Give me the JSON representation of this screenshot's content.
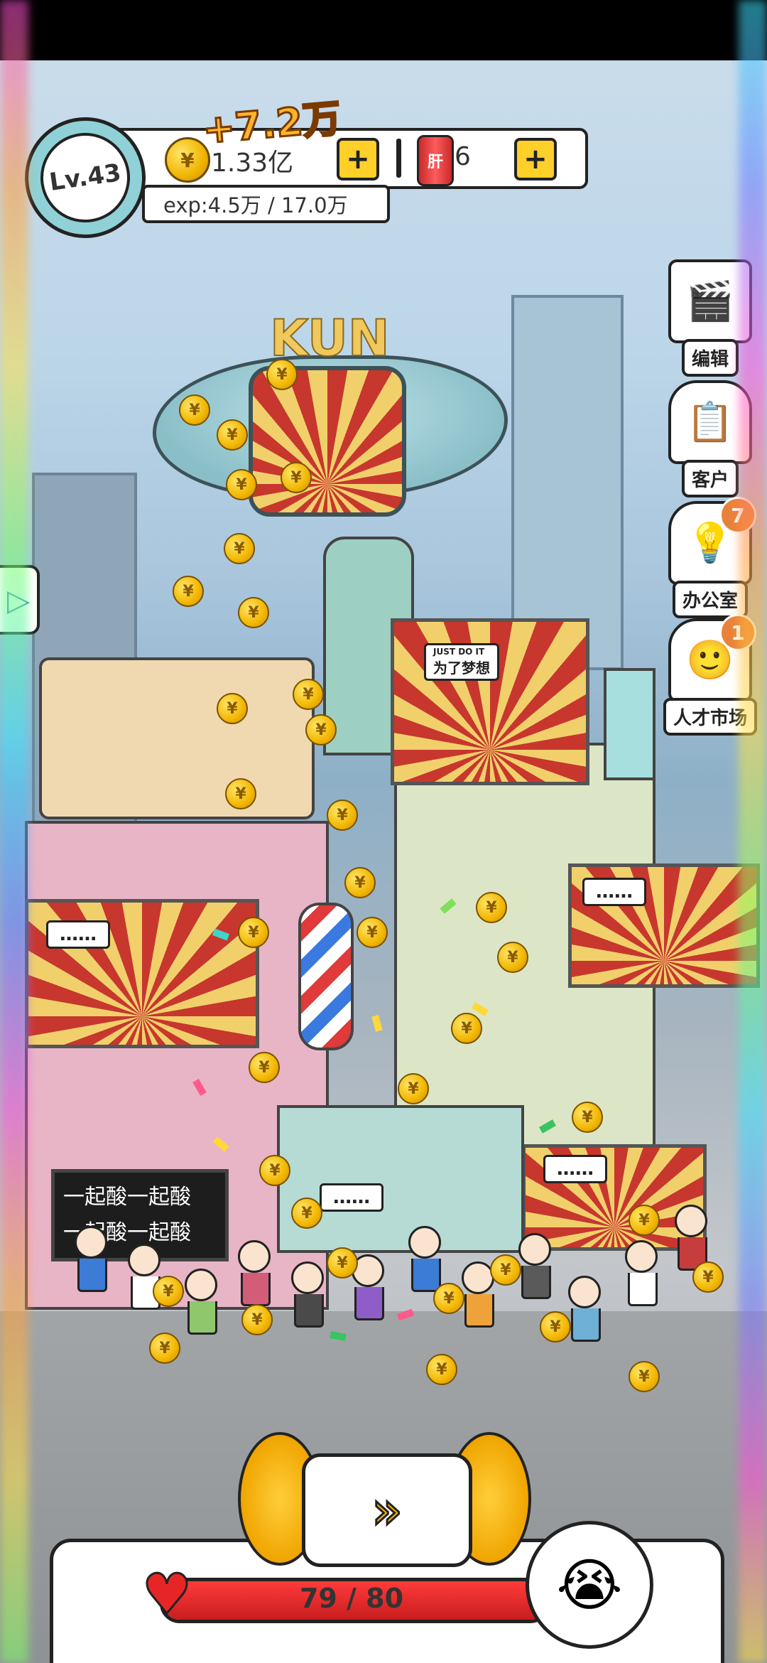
{
  "hud": {
    "level": "Lv.43",
    "coin_gain": "+7.2万",
    "coins": "1.33亿",
    "energy_can_label": "肝",
    "energy": "6",
    "exp": "exp:4.5万 / 17.0万",
    "plus": "+"
  },
  "side_menu": {
    "edit_label": "编辑",
    "customers_label": "客户",
    "office_label": "办公室",
    "office_badge": "7",
    "talent_market_label": "人才市场",
    "talent_market_badge": "1"
  },
  "scene": {
    "blimp_title": "KUN",
    "billboard_top_small": "JUST DO IT",
    "billboard_top_text": "为了梦想",
    "speech_ellipsis": "……",
    "chalkboard_line1": "一起酸一起酸",
    "chalkboard_line2": "一起酸一起酸",
    "coin_symbol": "¥"
  },
  "bottom": {
    "health_current": 79,
    "health_max": 80,
    "health_text": "79 / 80",
    "speed_icon": "fast-forward-icon"
  },
  "colors": {
    "coin": "#f2b600",
    "health": "#e62626",
    "accent": "#ffcf2a"
  }
}
